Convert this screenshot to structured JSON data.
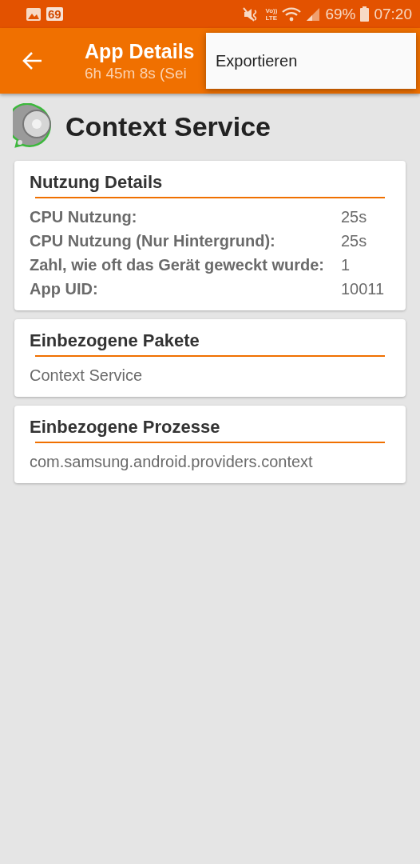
{
  "status_bar": {
    "badge": "69",
    "volte": "Vo))",
    "lte": "LTE",
    "battery": "69%",
    "time": "07:20"
  },
  "toolbar": {
    "title": "App Details",
    "subtitle": "6h 45m 8s (Sei"
  },
  "menu": {
    "items": [
      "Exportieren"
    ]
  },
  "app": {
    "name": "Context Service"
  },
  "cards": [
    {
      "kind": "table",
      "title": "Nutzung Details",
      "rows": [
        {
          "label": "CPU Nutzung:",
          "value": "25s"
        },
        {
          "label": "CPU Nutzung (Nur Hintergrund):",
          "value": "25s"
        },
        {
          "label": "Zahl, wie oft das Gerät geweckt wurde:",
          "value": "1"
        },
        {
          "label": "App UID:",
          "value": "10011"
        }
      ]
    },
    {
      "kind": "text",
      "title": "Einbezogene Pakete",
      "text": "Context Service"
    },
    {
      "kind": "text",
      "title": "Einbezogene Prozesse",
      "text": "com.samsung.android.providers.context"
    }
  ]
}
